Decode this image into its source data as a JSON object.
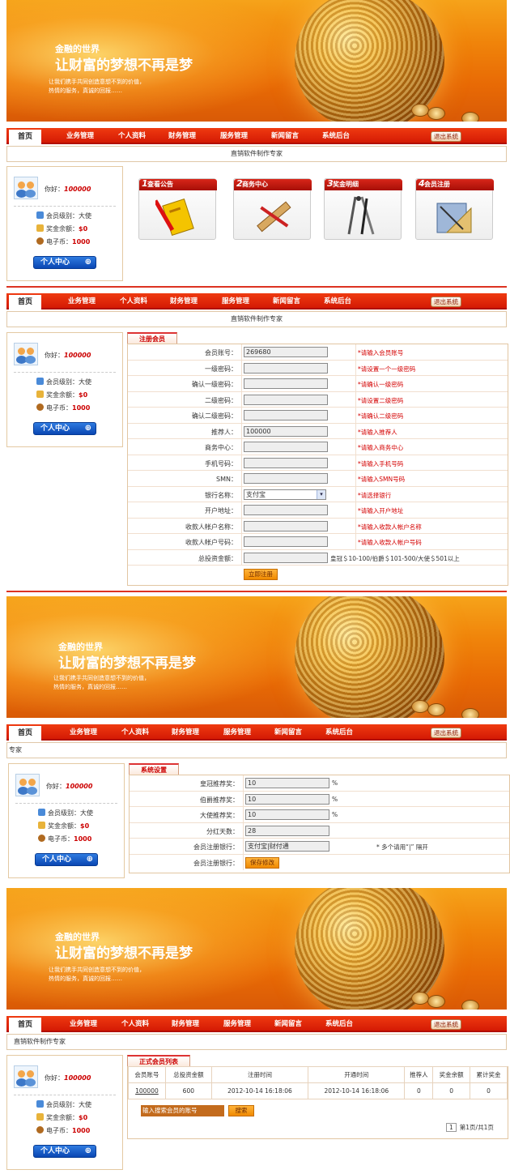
{
  "banner": {
    "title_small": "金融的世界",
    "title_big": "让财富的梦想不再是梦",
    "desc1": "让我们携手共同创造意想不到的价值，",
    "desc2": "热情的服务，真诚的回报……"
  },
  "nav": {
    "home": "首页",
    "items": [
      "业务管理",
      "个人资料",
      "财务管理",
      "服务管理",
      "新闻留言",
      "系统后台"
    ],
    "logout": "退出系统"
  },
  "subbar": {
    "text": "直销软件制作专家",
    "text_cut": "专家"
  },
  "user": {
    "hello": "你好：",
    "id": "100000",
    "level_label": "会员级别：",
    "level": "大使",
    "bonus_label": "奖金余额：",
    "bonus": "$0",
    "coin_label": "电子币：",
    "coin": "1000",
    "center_btn": "个人中心"
  },
  "tiles": [
    {
      "num": "1",
      "label": "查看公告"
    },
    {
      "num": "2",
      "label": "商务中心"
    },
    {
      "num": "3",
      "label": "奖金明细"
    },
    {
      "num": "4",
      "label": "会员注册"
    }
  ],
  "register": {
    "tab": "注册会员",
    "rows": [
      {
        "label": "会员账号：",
        "value": "269680",
        "hint": "*请输入会员账号"
      },
      {
        "label": "一级密码：",
        "value": "",
        "hint": "*请设置一个一级密码"
      },
      {
        "label": "确认一级密码：",
        "value": "",
        "hint": "*请确认一级密码"
      },
      {
        "label": "二级密码：",
        "value": "",
        "hint": "*请设置二级密码"
      },
      {
        "label": "确认二级密码：",
        "value": "",
        "hint": "*请确认二级密码"
      },
      {
        "label": "推荐人：",
        "value": "100000",
        "hint": "*请输入推荐人"
      },
      {
        "label": "商务中心：",
        "value": "",
        "hint": "*请输入商务中心"
      },
      {
        "label": "手机号码：",
        "value": "",
        "hint": "*请输入手机号码"
      },
      {
        "label": "SMN：",
        "value": "",
        "hint": "*请输入SMN号码"
      },
      {
        "label": "银行名称：",
        "value": "支付宝",
        "hint": "*请选择银行"
      },
      {
        "label": "开户地址：",
        "value": "",
        "hint": "*请输入开户地址"
      },
      {
        "label": "收款人帐户名称：",
        "value": "",
        "hint": "*请输入收款人帐户名称"
      },
      {
        "label": "收款人帐户号码：",
        "value": "",
        "hint": "*请输入收款人帐户号码"
      },
      {
        "label": "总投资金额：",
        "value": "",
        "hint": "皇冠＄10-100/伯爵＄101-500/大使＄501以上"
      }
    ],
    "submit": "立即注册"
  },
  "settings": {
    "tab": "系统设置",
    "rows": [
      {
        "label": "皇冠推荐奖：",
        "value": "10",
        "note": "%"
      },
      {
        "label": "伯爵推荐奖：",
        "value": "10",
        "note": "%"
      },
      {
        "label": "大使推荐奖：",
        "value": "10",
        "note": "%"
      },
      {
        "label": "分红天数：",
        "value": "28",
        "note": ""
      },
      {
        "label": "会员注册银行：",
        "value": "支付宝|财付通",
        "note": "* 多个请用“|” 隔开"
      }
    ],
    "save_label": "会员注册银行：",
    "save_btn": "保存修改"
  },
  "members": {
    "tab": "正式会员列表",
    "headers": [
      "会员账号",
      "总投资金额",
      "注册时间",
      "开通时间",
      "推荐人",
      "奖金余额",
      "累计奖金"
    ],
    "rows": [
      [
        "100000",
        "600",
        "2012-10-14 16:18:06",
        "2012-10-14 16:18:06",
        "0",
        "0",
        "0"
      ]
    ],
    "search_placeholder": "输入搜索会员的账号",
    "search_btn": "搜索",
    "page_num": "1",
    "page_info": "第1页/共1页"
  }
}
